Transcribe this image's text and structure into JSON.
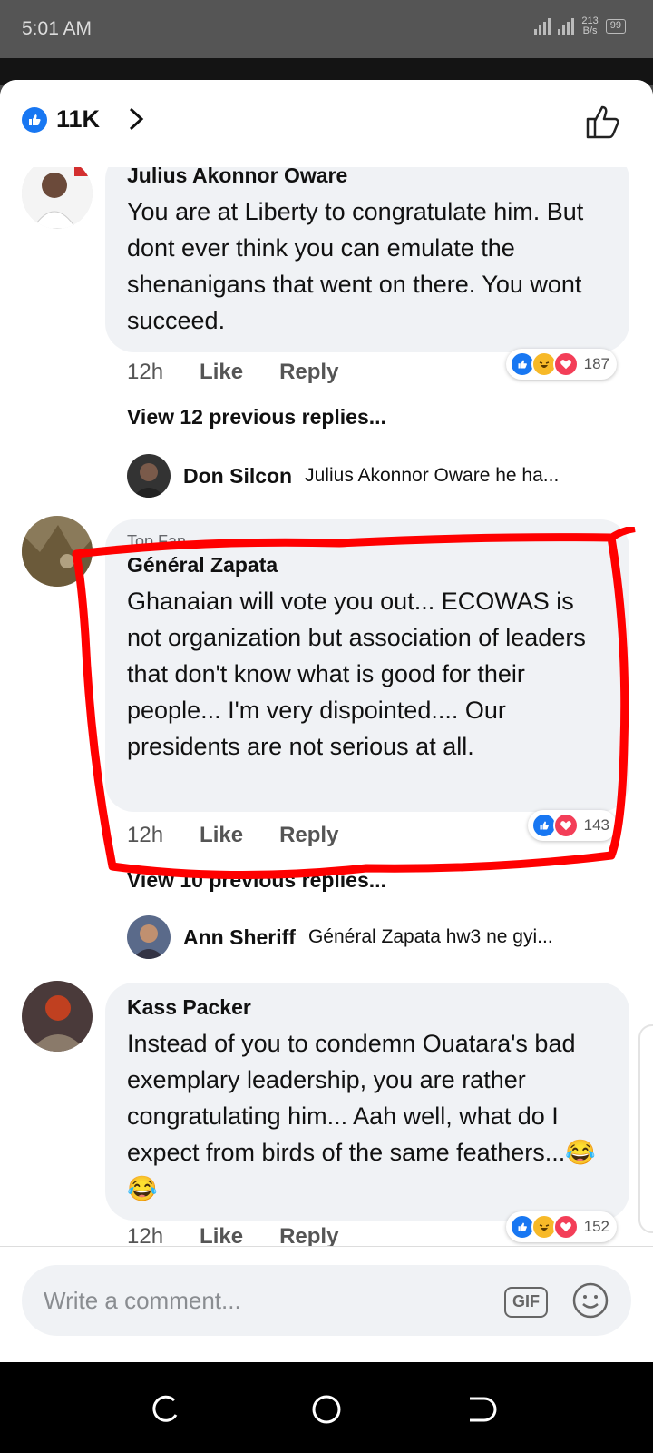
{
  "status_bar": {
    "time": "5:01 AM",
    "net_speed_value": "213",
    "net_speed_unit": "B/s",
    "battery": "99"
  },
  "header": {
    "like_count": "11K"
  },
  "comments": [
    {
      "author": "Julius Akonnor Oware",
      "text": "You are at Liberty to congratulate him. But dont ever think you can emulate the shenanigans that went on there. You wont succeed.",
      "time": "12h",
      "like_label": "Like",
      "reply_label": "Reply",
      "reactions": [
        "like",
        "haha",
        "love"
      ],
      "reaction_count": "187",
      "view_replies": "View 12 previous replies...",
      "reply_preview": {
        "name": "Don Silcon",
        "text": "Julius Akonnor Oware he ha..."
      }
    },
    {
      "badge": "Top Fan",
      "author": "Général Zapata",
      "text": "Ghanaian will vote you out... ECOWAS is not organization but association of leaders that don't know what is good for their people... I'm very dispointed.... Our presidents are not serious at all.",
      "time": "12h",
      "like_label": "Like",
      "reply_label": "Reply",
      "reactions": [
        "like",
        "love"
      ],
      "reaction_count": "143",
      "view_replies": "View 10 previous replies...",
      "reply_preview": {
        "name": "Ann Sheriff",
        "text": "Général Zapata hw3 ne gyi..."
      }
    },
    {
      "author": "Kass Packer",
      "text": "Instead of you to condemn Ouatara's bad exemplary leadership, you are rather congratulating him... Aah well, what do I expect from birds of the same feathers...😂😂",
      "time": "12h",
      "like_label": "Like",
      "reply_label": "Reply",
      "reactions": [
        "like",
        "haha",
        "love"
      ],
      "reaction_count": "152"
    }
  ],
  "composer": {
    "placeholder": "Write a comment...",
    "gif_label": "GIF"
  },
  "colors": {
    "accent": "#1877f2",
    "haha": "#f7b928",
    "love": "#f33e58",
    "annotation": "#ff0000"
  }
}
